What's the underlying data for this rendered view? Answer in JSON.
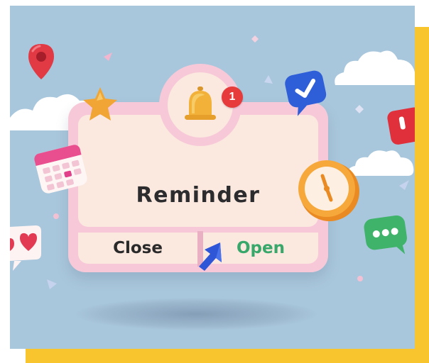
{
  "dialog": {
    "title": "Reminder",
    "close_label": "Close",
    "open_label": "Open"
  },
  "notification_badge": {
    "count": "1"
  },
  "colors": {
    "background": "#a9c7dc",
    "frame_accent": "#f9c52f",
    "dialog_border": "#f7c9d8",
    "dialog_fill": "#fbe8df",
    "open_text": "#38a86a",
    "close_text": "#2a2a2a",
    "badge": "#e73a3a"
  },
  "icons": [
    "bell-icon",
    "map-pin-icon",
    "star-icon",
    "checkmark-bubble-icon",
    "calendar-icon",
    "clock-icon",
    "heart-bubble-icon",
    "chat-bubble-icon",
    "cursor-arrow-icon",
    "notification-badge-icon"
  ]
}
